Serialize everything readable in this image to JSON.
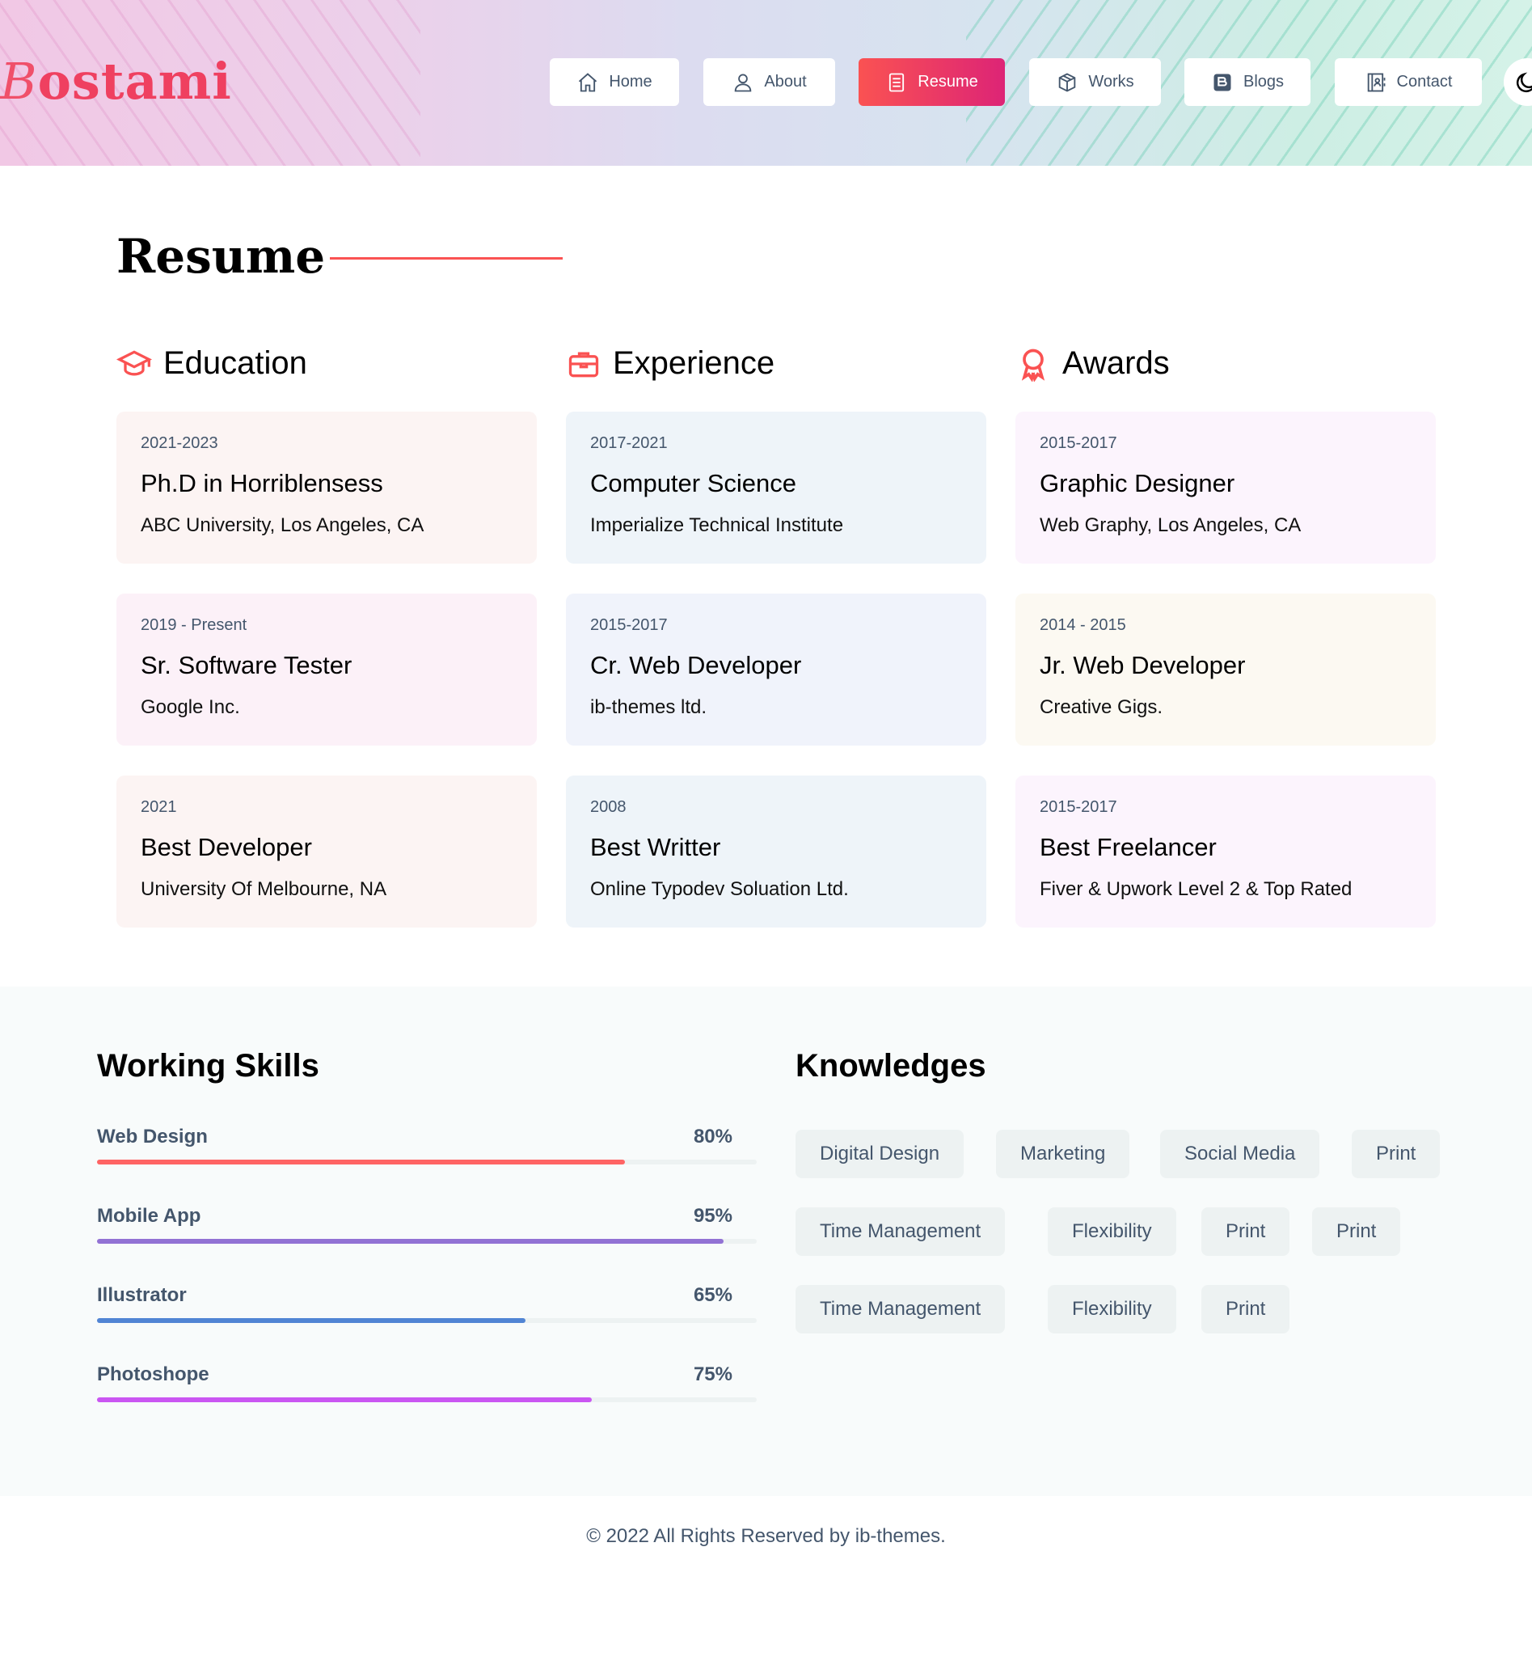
{
  "logo": {
    "first_letter": "B",
    "rest": "ostami"
  },
  "nav": [
    {
      "label": "Home",
      "icon": "home-icon"
    },
    {
      "label": "About",
      "icon": "user-icon"
    },
    {
      "label": "Resume",
      "icon": "document-icon",
      "active": true
    },
    {
      "label": "Works",
      "icon": "cube-icon"
    },
    {
      "label": "Blogs",
      "icon": "blog-icon"
    },
    {
      "label": "Contact",
      "icon": "contact-book-icon"
    }
  ],
  "page_title": "Resume",
  "columns": {
    "education": {
      "heading": "Education",
      "items": [
        {
          "date": "2021-2023",
          "title": "Ph.D in Horriblensess",
          "place": "ABC University, Los Angeles, CA",
          "bg": "#fcf4f3"
        },
        {
          "date": "2019 - Present",
          "title": "Sr. Software Tester",
          "place": "Google Inc.",
          "bg": "#fcf1f8"
        },
        {
          "date": "2021",
          "title": "Best Developer",
          "place": "University Of Melbourne, NA",
          "bg": "#fcf4f3"
        }
      ]
    },
    "experience": {
      "heading": "Experience",
      "items": [
        {
          "date": "2017-2021",
          "title": "Computer Science",
          "place": "Imperialize Technical Institute",
          "bg": "#eef4f9"
        },
        {
          "date": "2015-2017",
          "title": "Cr. Web Developer",
          "place": "ib-themes ltd.",
          "bg": "#f0f3fb"
        },
        {
          "date": "2008",
          "title": "Best Writter",
          "place": "Online Typodev Soluation Ltd.",
          "bg": "#eef4f9"
        }
      ]
    },
    "awards": {
      "heading": "Awards",
      "items": [
        {
          "date": "2015-2017",
          "title": "Graphic Designer",
          "place": "Web Graphy, Los Angeles, CA",
          "bg": "#fcf4fd"
        },
        {
          "date": "2014 - 2015",
          "title": "Jr. Web Developer",
          "place": "Creative Gigs.",
          "bg": "#fcf9f2"
        },
        {
          "date": "2015-2017",
          "title": "Best Freelancer",
          "place": "Fiver & Upwork Level 2 & Top Rated",
          "bg": "#fcf4fd"
        }
      ]
    }
  },
  "skills": {
    "heading": "Working Skills",
    "items": [
      {
        "name": "Web Design",
        "percent_label": "80%",
        "value": 80,
        "color": "#ff6464"
      },
      {
        "name": "Mobile App",
        "percent_label": "95%",
        "value": 95,
        "color": "#9272d4"
      },
      {
        "name": "Illustrator",
        "percent_label": "65%",
        "value": 65,
        "color": "#5185d4"
      },
      {
        "name": "Photoshope",
        "percent_label": "75%",
        "value": 75,
        "color": "#ca56f2"
      }
    ]
  },
  "knowledges": {
    "heading": "Knowledges",
    "rows": [
      [
        "Digital Design",
        "Marketing",
        "Social Media",
        "Print"
      ],
      [
        "Time Management",
        "Flexibility",
        "Print",
        "Print"
      ],
      [
        "Time Management",
        "Flexibility",
        "Print"
      ]
    ]
  },
  "footer": "© 2022 All Rights Reserved by ib-themes.",
  "colors": {
    "accent": "#fa5252",
    "accent_gradient_end": "#dd2476",
    "text_muted": "#44566c"
  }
}
